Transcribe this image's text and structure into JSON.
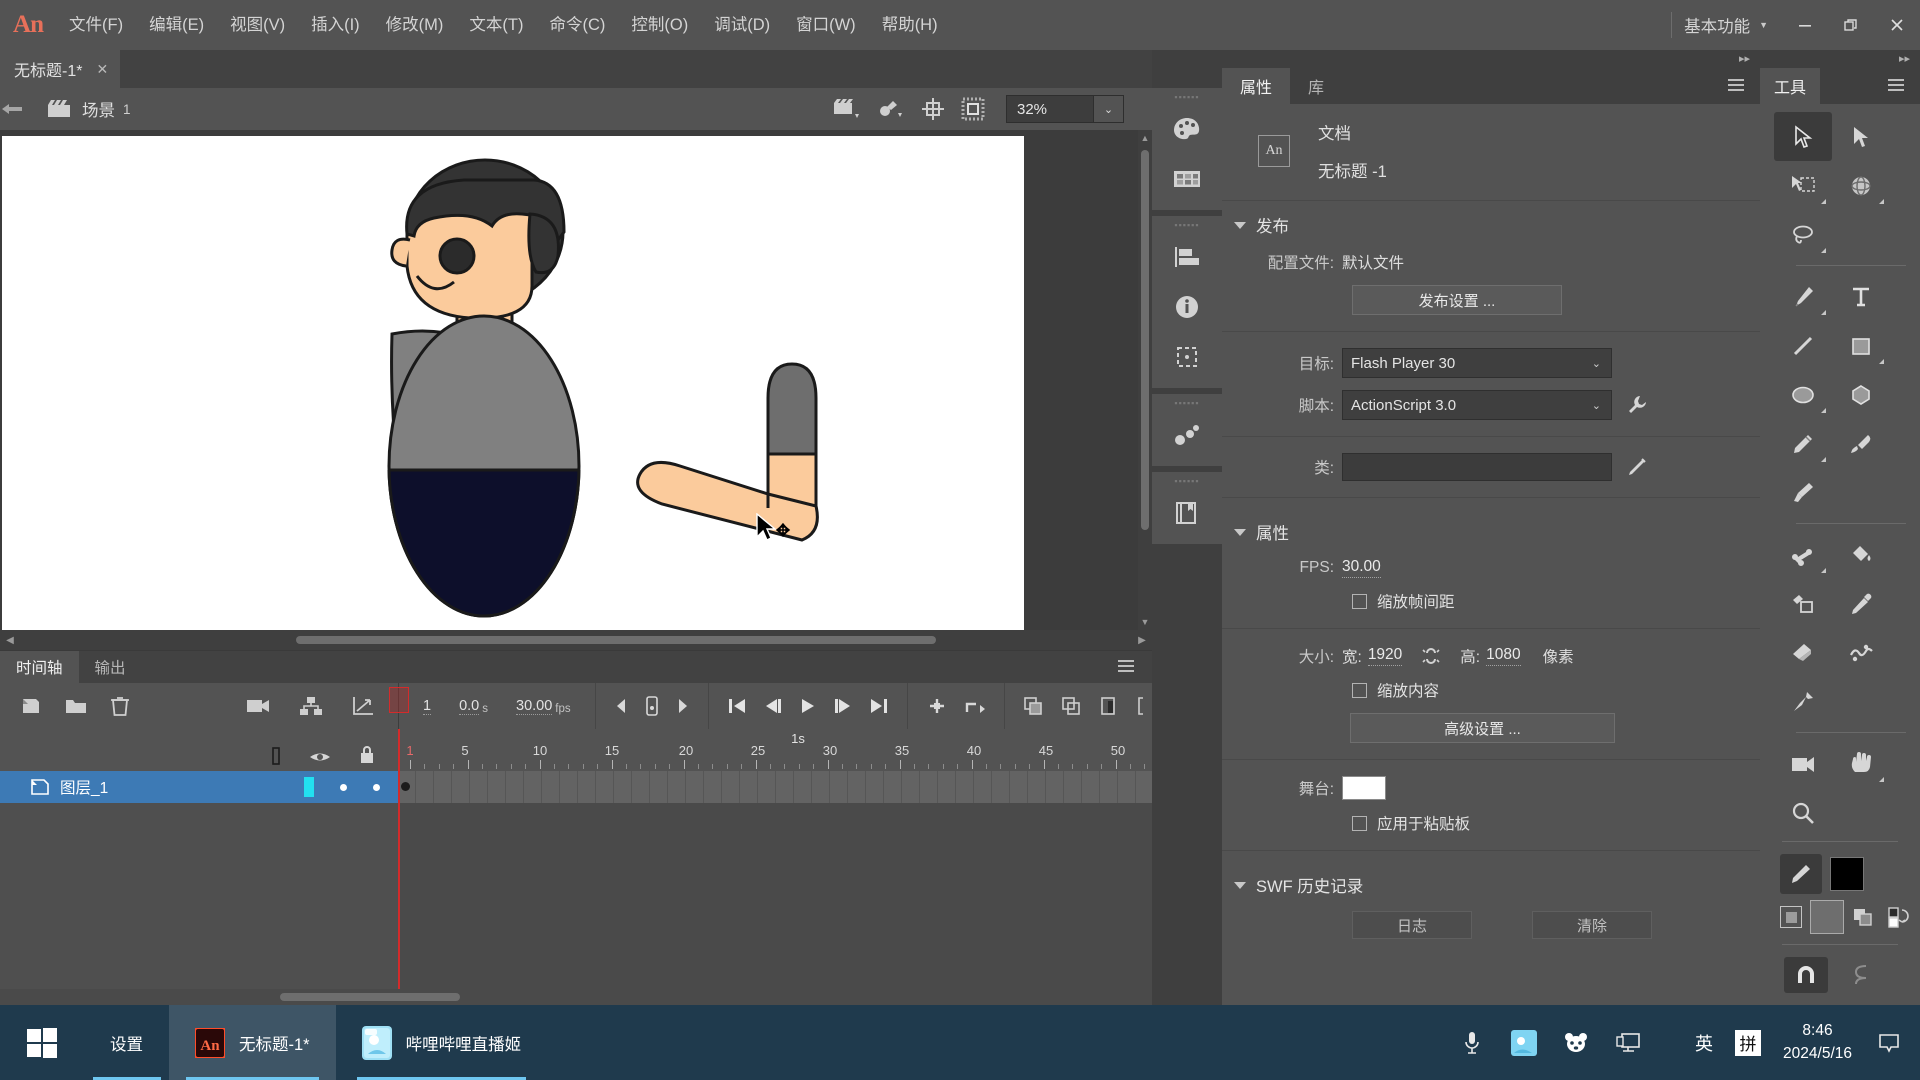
{
  "app": {
    "logo": "An",
    "menus": [
      {
        "label": "文件(F)"
      },
      {
        "label": "编辑(E)"
      },
      {
        "label": "视图(V)"
      },
      {
        "label": "插入(I)"
      },
      {
        "label": "修改(M)"
      },
      {
        "label": "文本(T)"
      },
      {
        "label": "命令(C)"
      },
      {
        "label": "控制(O)"
      },
      {
        "label": "调试(D)"
      },
      {
        "label": "窗口(W)"
      },
      {
        "label": "帮助(H)"
      }
    ],
    "workspace": "基本功能",
    "window_controls": {
      "minimize": "—",
      "restore": "❐",
      "close": "✕"
    }
  },
  "document": {
    "tab_title": "无标题-1*",
    "tab_close": "✕",
    "scene_label": "场景",
    "scene_number": "1",
    "zoom": "32%"
  },
  "timeline": {
    "tabs": [
      {
        "label": "时间轴",
        "active": true
      },
      {
        "label": "输出",
        "active": false
      }
    ],
    "current_frame": "1",
    "elapsed_time": "0.0",
    "elapsed_unit": "s",
    "fps": "30.00",
    "fps_unit": "fps",
    "ruler_seconds": [
      {
        "label": "1s",
        "frame": 30
      }
    ],
    "ruler_ticks": [
      1,
      5,
      10,
      15,
      20,
      25,
      30,
      35,
      40,
      45,
      50
    ],
    "layers": [
      {
        "name": "图层_1",
        "selected": true,
        "has_keyframe": true
      }
    ]
  },
  "properties": {
    "tabs": [
      {
        "label": "属性",
        "active": true
      },
      {
        "label": "库",
        "active": false
      }
    ],
    "doc_badge": "An",
    "doc_kind": "文档",
    "doc_name": "无标题 -1",
    "publish": {
      "section_title": "发布",
      "profile_label": "配置文件:",
      "profile_value": "默认文件",
      "publish_settings_button": "发布设置 ...",
      "target_label": "目标:",
      "target_value": "Flash Player 30",
      "script_label": "脚本:",
      "script_value": "ActionScript 3.0",
      "class_label": "类:",
      "class_value": ""
    },
    "attributes": {
      "section_title": "属性",
      "fps_label": "FPS:",
      "fps_value": "30.00",
      "scale_spacing_label": "缩放帧间距",
      "size_label": "大小:",
      "width_label": "宽:",
      "width_value": "1920",
      "height_label": "高:",
      "height_value": "1080",
      "unit": "像素",
      "scale_content_label": "缩放内容",
      "advanced_settings_button": "高级设置 ...",
      "stage_label": "舞台:",
      "stage_color": "#ffffff",
      "apply_to_pasteboard_label": "应用于粘贴板"
    },
    "swf_history": {
      "section_title": "SWF 历史记录",
      "log_button": "日志",
      "clear_button": "清除"
    }
  },
  "tools": {
    "tab_label": "工具",
    "items": [
      {
        "name": "selection-tool",
        "selected": true
      },
      {
        "name": "subselection-tool",
        "selected": false
      },
      {
        "name": "free-transform-tool",
        "selected": false
      },
      {
        "name": "3d-rotation-tool",
        "selected": false
      },
      {
        "name": "lasso-tool",
        "selected": false
      },
      {
        "name": "pen-tool",
        "selected": false
      },
      {
        "name": "text-tool",
        "selected": false
      },
      {
        "name": "line-tool",
        "selected": false
      },
      {
        "name": "rectangle-tool",
        "selected": false
      },
      {
        "name": "oval-tool",
        "selected": false
      },
      {
        "name": "polystar-tool",
        "selected": false
      },
      {
        "name": "pencil-tool",
        "selected": false
      },
      {
        "name": "brush-tool",
        "selected": false
      },
      {
        "name": "paint-brush-tool",
        "selected": false
      },
      {
        "name": "bone-tool",
        "selected": false
      },
      {
        "name": "paint-bucket-tool",
        "selected": false
      },
      {
        "name": "ink-bottle-tool",
        "selected": false
      },
      {
        "name": "eyedropper-tool",
        "selected": false
      },
      {
        "name": "eraser-tool",
        "selected": false
      },
      {
        "name": "width-tool",
        "selected": false
      },
      {
        "name": "asset-warp-tool",
        "selected": false
      },
      {
        "name": "camera-tool",
        "selected": false
      },
      {
        "name": "hand-tool",
        "selected": false
      },
      {
        "name": "zoom-tool",
        "selected": false
      }
    ],
    "stroke_color": "#000000",
    "fill_color": "#6e6e6e"
  },
  "stage": {
    "background": "#ffffff",
    "artwork": {
      "skin_color": "#fbcb9c",
      "hair_color": "#333333",
      "shirt_color": "#808080",
      "pants_color": "#0d0f2b",
      "outline_color": "#1a1a1a",
      "sleeve_color": "#6e6e6e"
    }
  },
  "taskbar": {
    "items": [
      {
        "label": "设置",
        "active": false,
        "icon": "settings-icon"
      },
      {
        "label": "无标题-1*",
        "active": true,
        "icon": "animate-icon"
      },
      {
        "label": "哔哩哔哩直播姬",
        "active": false,
        "icon": "bilibili-icon"
      }
    ],
    "tray": [
      {
        "name": "microphone-icon"
      },
      {
        "name": "bilibili-tray-icon"
      },
      {
        "name": "panda-icon"
      },
      {
        "name": "display-icon"
      }
    ],
    "ime_language": "英",
    "ime_mode": "拼",
    "time": "8:46",
    "date": "2024/5/16",
    "notification": "notification-icon"
  }
}
